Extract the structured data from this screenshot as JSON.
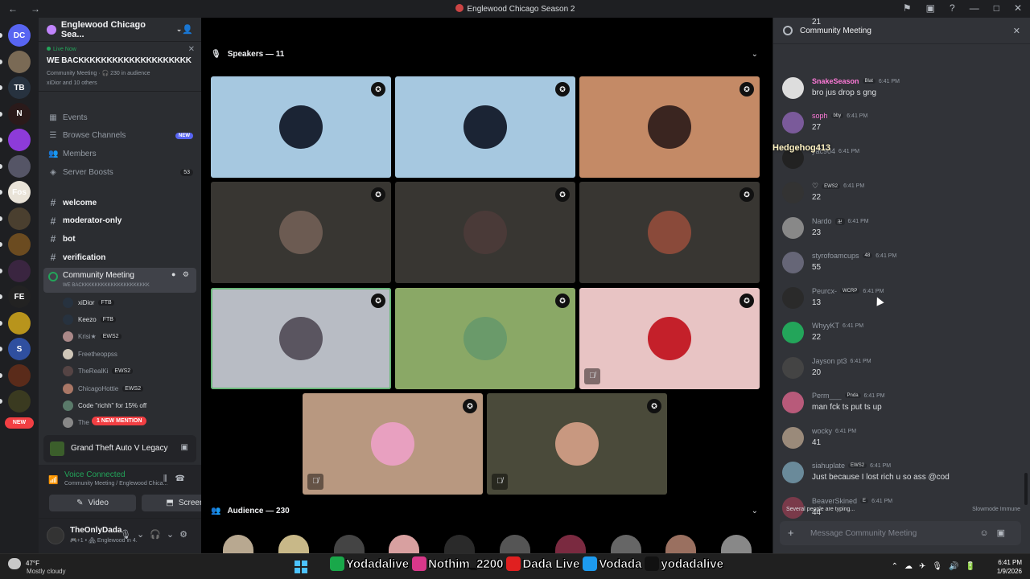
{
  "window": {
    "title": "Englewood Chicago Season 2"
  },
  "rail": {
    "servers": [
      {
        "label": "DC",
        "color": "#5865f2",
        "badge": "390"
      },
      {
        "label": "",
        "color": "#7a6a55",
        "badge": "1"
      },
      {
        "label": "TB",
        "color": "#27323f",
        "badge": ""
      },
      {
        "label": "N",
        "color": "#2a1a1a",
        "badge": "3"
      },
      {
        "label": "",
        "color": "#8d3bd9",
        "badge": "2"
      },
      {
        "label": "",
        "color": "#555566",
        "badge": "7"
      },
      {
        "label": "Fos",
        "color": "#e9e3d8",
        "badge": "9"
      },
      {
        "label": "",
        "color": "#4a3f2f",
        "badge": "4"
      },
      {
        "label": "",
        "color": "#6b4b20",
        "badge": "2"
      },
      {
        "label": "",
        "color": "#3a2540",
        "badge": ""
      },
      {
        "label": "FE",
        "color": "#222",
        "badge": "6"
      },
      {
        "label": "",
        "color": "#b8941c",
        "badge": ""
      },
      {
        "label": "S",
        "color": "#2f4f9f",
        "badge": "6"
      },
      {
        "label": "",
        "color": "#5a2b1a",
        "badge": "3"
      },
      {
        "label": "",
        "color": "#3a3a20",
        "badge": ""
      }
    ],
    "new_label": "NEW"
  },
  "sidebar": {
    "server_name": "Englewood Chicago Sea...",
    "live": {
      "badge": "Live Now",
      "title": "WE BACKKKKKKKKKKKKKKKKKKKK",
      "meta": "Community Meeting · 🎧 230 in audience",
      "listeners": "xiDior and 10 others"
    },
    "menu": [
      {
        "icon": "calendar-icon",
        "glyph": "▦",
        "label": "Events"
      },
      {
        "icon": "browse-icon",
        "glyph": "☰",
        "label": "Browse Channels",
        "pill": "NEW"
      },
      {
        "icon": "members-icon",
        "glyph": "👥",
        "label": "Members"
      },
      {
        "icon": "boost-icon",
        "glyph": "◈",
        "label": "Server Boosts",
        "count": "53"
      }
    ],
    "channels": [
      "welcome",
      "moderator-only",
      "bot",
      "verification"
    ],
    "voice_channel": {
      "name": "Community Meeting",
      "subtitle": "WE BACKKKKKKKKKKKKKKKKKKKKK"
    },
    "voice_users": [
      {
        "name": "xiDior",
        "tag": "FTB",
        "color": "#27323f"
      },
      {
        "name": "Keezo",
        "tag": "FTB",
        "color": "#27323f"
      },
      {
        "name": "Krisi★",
        "tag": "EWS2",
        "color": "#a88"
      },
      {
        "name": "Freetheoppss",
        "tag": "",
        "color": "#cfc6b8"
      },
      {
        "name": "TheRealKi",
        "tag": "EWS2",
        "color": "#544"
      },
      {
        "name": "ChicagoHottie",
        "tag": "EWS2",
        "color": "#a76"
      },
      {
        "name": "Code \"richh\" for 15% off",
        "tag": "",
        "color": "#5a7a6a"
      },
      {
        "name": "The",
        "tag": "2",
        "color": "#888"
      }
    ],
    "mention_pill": "1 NEW MENTION",
    "activity": "Grand Theft Auto V Legacy",
    "voice_status": "Voice Connected",
    "voice_location": "Community Meeting / Englewood Chica...",
    "video_label": "Video",
    "screen_label": "Screen",
    "user": {
      "name": "TheOnlyDada",
      "status": "🎮+1 • 🏘 Englewood in 4."
    }
  },
  "stage": {
    "speakers_label": "Speakers — 11",
    "audience_label": "Audience — 230",
    "tiles": [
      {
        "bg": "#a6c8e0",
        "av": "#1b2434",
        "muted": false
      },
      {
        "bg": "#a6c8e0",
        "av": "#1b2434",
        "muted": false
      },
      {
        "bg": "#c48a66",
        "av": "#3a2520",
        "muted": false
      },
      {
        "bg": "#383632",
        "av": "#6c5b52",
        "muted": false
      },
      {
        "bg": "#383632",
        "av": "#4a3a38",
        "muted": false
      },
      {
        "bg": "#383632",
        "av": "#8a4a3a",
        "muted": false
      },
      {
        "bg": "#b8bcc4",
        "av": "#5a5560",
        "muted": false
      },
      {
        "bg": "#8aa866",
        "av": "#6a9a6a",
        "muted": false
      },
      {
        "bg": "#e8c4c4",
        "av": "#c4202a",
        "muted": true
      },
      {
        "bg": "#b89880",
        "av": "#e8a0c0",
        "muted": true
      },
      {
        "bg": "#4a4a3a",
        "av": "#c89880",
        "muted": true
      }
    ],
    "audience": [
      "#b8a890",
      "#c8b888",
      "#444",
      "#d8a0a0",
      "#2a2a2a",
      "#555",
      "#7a2a40",
      "#666",
      "#9a7060",
      "#888"
    ]
  },
  "chat": {
    "title": "Community Meeting",
    "messages": [
      {
        "user": "",
        "tags": [],
        "time": "",
        "text": "21",
        "color": "#dbdee1",
        "av": ""
      },
      {
        "user": "SnakeSeason",
        "tags": [
          "Blat"
        ],
        "time": "6:41 PM",
        "text": "bro jus drop s gng",
        "color": "#ff7ad9",
        "av": "#ddd"
      },
      {
        "user": "soph",
        "tags": [
          "bby"
        ],
        "time": "6:41 PM",
        "text": "27",
        "color": "#ff7ad9",
        "av": "#7a5a9a"
      },
      {
        "user": "yac904",
        "tags": [],
        "time": "6:41 PM",
        "text": "",
        "color": "#949ba4",
        "av": "#222"
      },
      {
        "user": "♡",
        "tags": [
          "EWS2"
        ],
        "time": "6:41 PM",
        "text": "22",
        "color": "#dbdee1",
        "av": "#333"
      },
      {
        "user": "Nardo",
        "tags": [
          "卍"
        ],
        "time": "6:41 PM",
        "text": "23",
        "color": "#949ba4",
        "av": "#888"
      },
      {
        "user": "styrofoamcups",
        "tags": [
          "48"
        ],
        "time": "6:41 PM",
        "text": "55",
        "color": "#949ba4",
        "av": "#667"
      },
      {
        "user": "Peurcx-",
        "tags": [
          "WCRP"
        ],
        "time": "6:41 PM",
        "text": "13",
        "color": "#949ba4",
        "av": "#2a2a2a"
      },
      {
        "user": "WhyyKT",
        "tags": [],
        "time": "6:41 PM",
        "text": "22",
        "color": "#949ba4",
        "av": "#23a55a"
      },
      {
        "user": "Jayson pt3",
        "tags": [],
        "time": "6:41 PM",
        "text": "20",
        "color": "#949ba4",
        "av": "#444"
      },
      {
        "user": "Perm___",
        "tags": [
          "Pnda"
        ],
        "time": "6:41 PM",
        "text": "man fck ts put ts up",
        "color": "#949ba4",
        "av": "#b85a7a"
      },
      {
        "user": "wocky",
        "tags": [],
        "time": "6:41 PM",
        "text": "41",
        "color": "#949ba4",
        "av": "#9a8a7a"
      },
      {
        "user": "siahuplate",
        "tags": [
          "EWS2"
        ],
        "time": "6:41 PM",
        "text": "Just because I lost rich u so ass @cod",
        "color": "#949ba4",
        "av": "#6a8a9a"
      },
      {
        "user": "BeaverSkined",
        "tags": [
          "E"
        ],
        "time": "6:41 PM",
        "text": "44",
        "color": "#949ba4",
        "av": "#7a3a4a"
      }
    ],
    "typing": "Several people are typing...",
    "slowmode": "Slowmode Immune",
    "input_placeholder": "Message Community Meeting",
    "overlay_name": "Hedgehog413"
  },
  "taskbar": {
    "temp": "47°F",
    "weather": "Mostly cloudy",
    "socials": [
      {
        "label": "Yodadalive",
        "color": "#19a84a"
      },
      {
        "label": "Nothim_2200",
        "color": "#d8388a"
      },
      {
        "label": "Dada Live",
        "color": "#e02020"
      },
      {
        "label": "Vodada",
        "color": "#1d9bf0"
      },
      {
        "label": "yodadalive",
        "color": "#111"
      }
    ],
    "time": "6:41 PM",
    "date": "1/9/2026"
  }
}
